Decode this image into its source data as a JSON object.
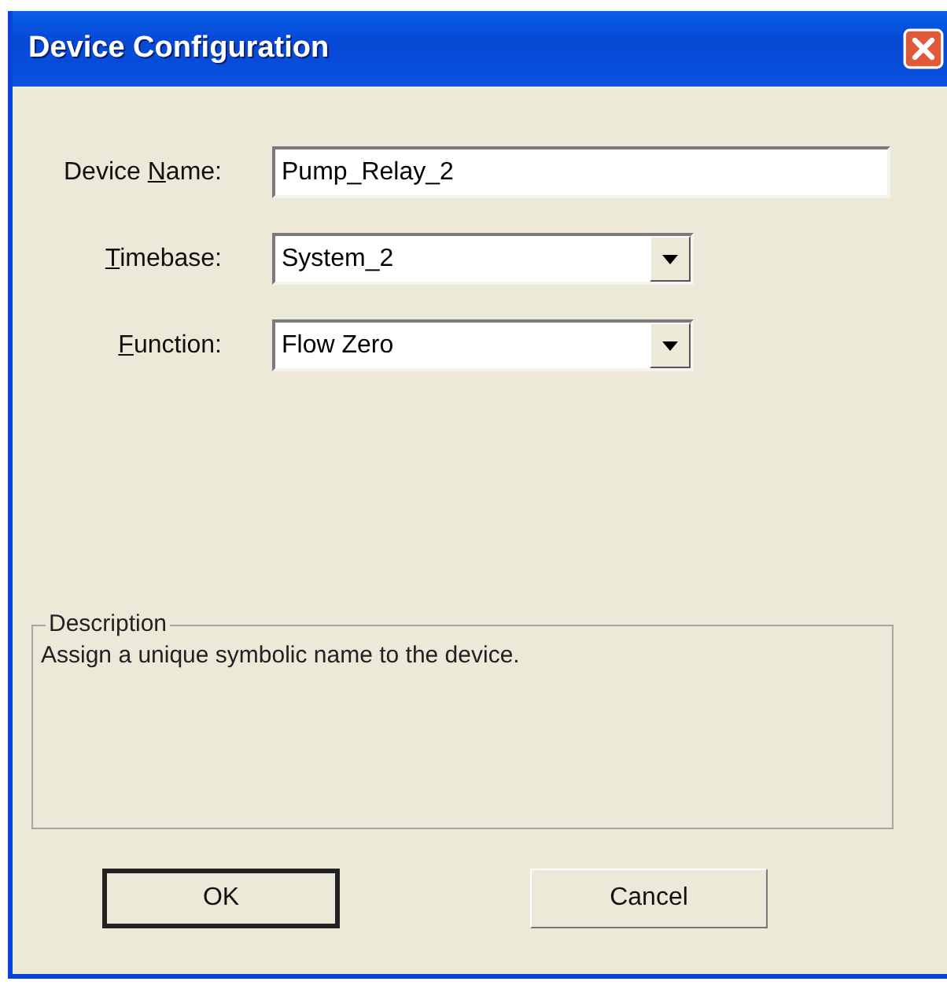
{
  "window": {
    "title": "Device Configuration"
  },
  "fields": [
    {
      "kind": "text",
      "label": {
        "before": "Device ",
        "key": "N",
        "after": "ame:"
      },
      "value": "Pump_Relay_2"
    },
    {
      "kind": "dropdown",
      "label": {
        "key": "T",
        "after": "imebase:"
      },
      "value": "System_2"
    },
    {
      "kind": "dropdown",
      "label": {
        "key": "F",
        "after": "unction:"
      },
      "value": "Flow Zero"
    }
  ],
  "description": {
    "title": "Description",
    "text": "Assign a unique symbolic name to the device."
  },
  "buttons": [
    {
      "label": "OK",
      "default": true
    },
    {
      "label": "Cancel",
      "default": false
    }
  ]
}
